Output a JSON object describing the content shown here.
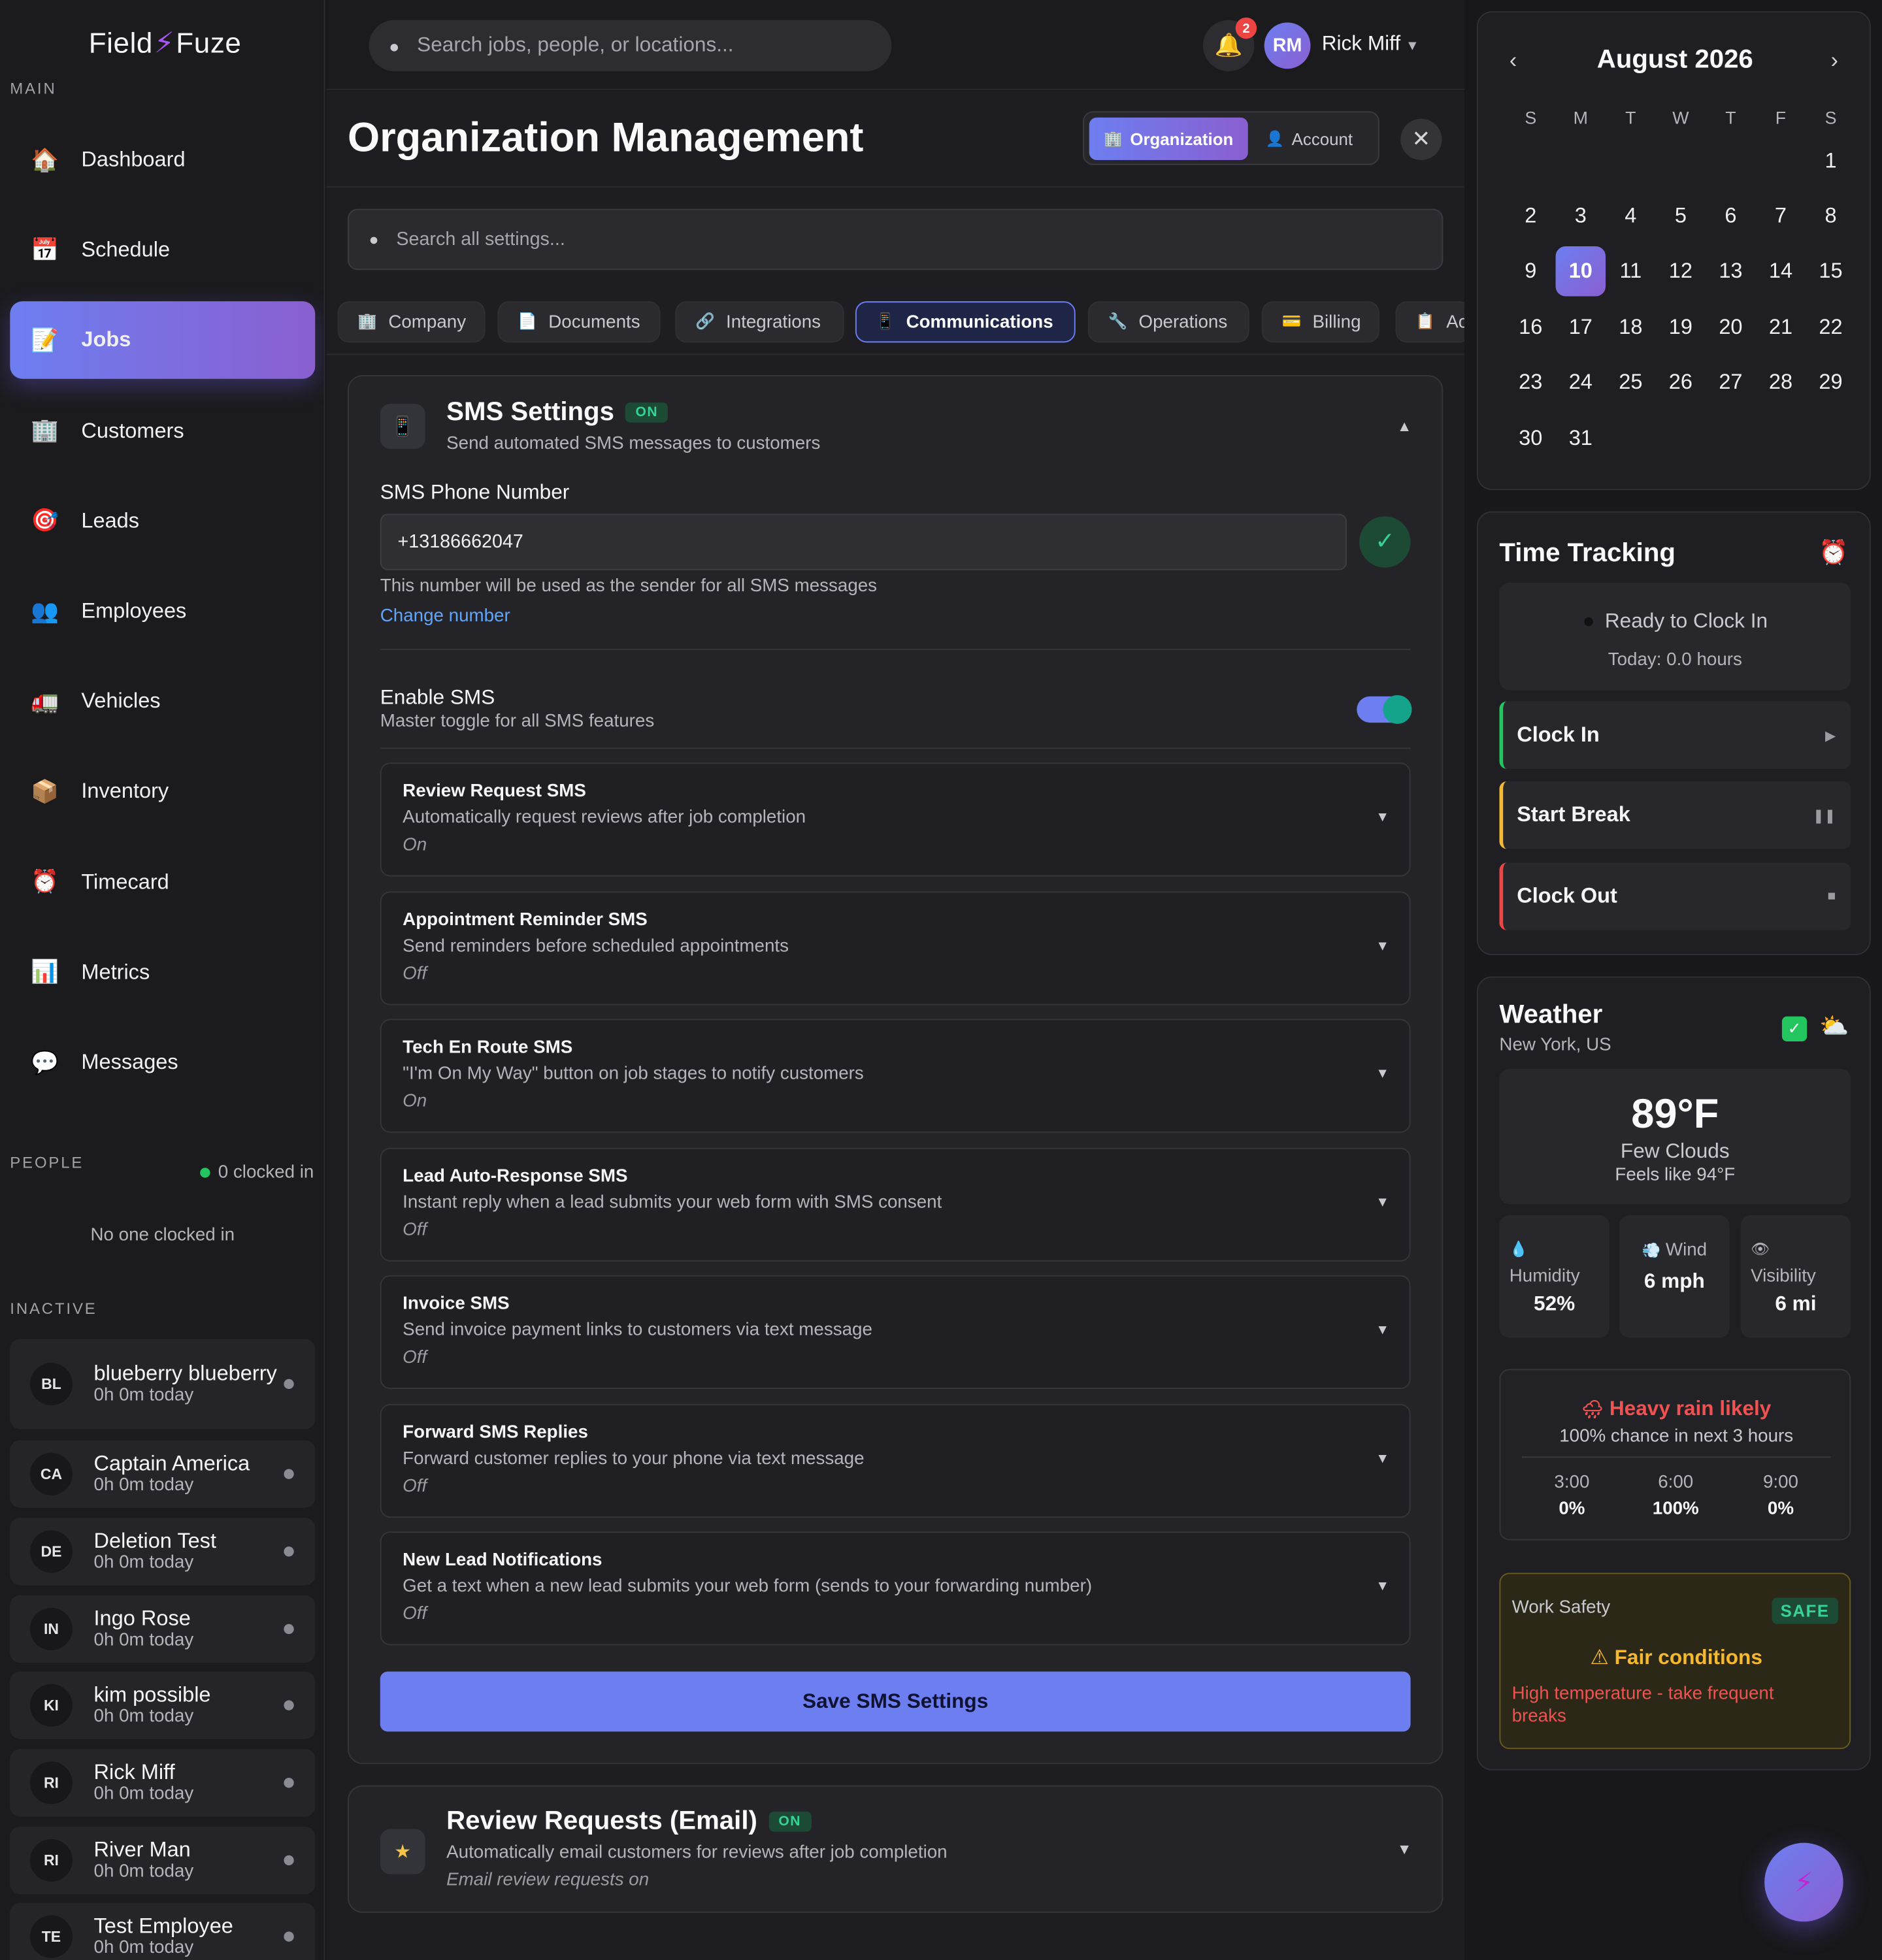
{
  "brand": {
    "name_left": "Field",
    "name_right": "Fuze",
    "logo_icon": "lightning-bolt-icon"
  },
  "sidebar": {
    "main_label": "MAIN",
    "items": [
      {
        "label": "Dashboard",
        "icon": "house-icon",
        "glyph": "🏠",
        "active": false
      },
      {
        "label": "Schedule",
        "icon": "calendar-icon",
        "glyph": "📅",
        "active": false
      },
      {
        "label": "Jobs",
        "icon": "memo-icon",
        "glyph": "📝",
        "active": true
      },
      {
        "label": "Customers",
        "icon": "office-building-icon",
        "glyph": "🏢",
        "active": false
      },
      {
        "label": "Leads",
        "icon": "target-icon",
        "glyph": "🎯",
        "active": false
      },
      {
        "label": "Employees",
        "icon": "people-icon",
        "glyph": "👥",
        "active": false
      },
      {
        "label": "Vehicles",
        "icon": "truck-icon",
        "glyph": "🚛",
        "active": false
      },
      {
        "label": "Inventory",
        "icon": "package-icon",
        "glyph": "📦",
        "active": false
      },
      {
        "label": "Timecard",
        "icon": "alarm-clock-icon",
        "glyph": "⏰",
        "active": false
      },
      {
        "label": "Metrics",
        "icon": "bar-chart-icon",
        "glyph": "📊",
        "active": false
      },
      {
        "label": "Messages",
        "icon": "speech-bubble-icon",
        "glyph": "💬",
        "active": false
      }
    ],
    "people_label": "PEOPLE",
    "clocked_in": "0 clocked in",
    "no_one": "No one clocked in",
    "inactive_label": "INACTIVE",
    "employees": [
      {
        "initials": "BL",
        "name": "blueberry blueberry",
        "time": "0h 0m today"
      },
      {
        "initials": "CA",
        "name": "Captain America",
        "time": "0h 0m today"
      },
      {
        "initials": "DE",
        "name": "Deletion Test",
        "time": "0h 0m today"
      },
      {
        "initials": "IN",
        "name": "Ingo Rose",
        "time": "0h 0m today"
      },
      {
        "initials": "KI",
        "name": "kim possible",
        "time": "0h 0m today"
      },
      {
        "initials": "RI",
        "name": "Rick Miff",
        "time": "0h 0m today"
      },
      {
        "initials": "RI",
        "name": "River Man",
        "time": "0h 0m today"
      },
      {
        "initials": "TE",
        "name": "Test Employee",
        "time": "0h 0m today"
      }
    ]
  },
  "topbar": {
    "search_placeholder": "Search jobs, people, or locations...",
    "notifications": "2",
    "user_initials": "RM",
    "user_name": "Rick Miff"
  },
  "page": {
    "title": "Organization Management",
    "mode_org": "Organization",
    "mode_account": "Account",
    "settings_search_placeholder": "Search all settings...",
    "tabs": [
      {
        "label": "Company",
        "icon": "building-icon",
        "glyph": "🏢",
        "active": false
      },
      {
        "label": "Documents",
        "icon": "document-icon",
        "glyph": "📄",
        "active": false
      },
      {
        "label": "Integrations",
        "icon": "link-icon",
        "glyph": "🔗",
        "active": false
      },
      {
        "label": "Communications",
        "icon": "phone-icon",
        "glyph": "📱",
        "active": true
      },
      {
        "label": "Operations",
        "icon": "wrench-icon",
        "glyph": "🔧",
        "active": false
      },
      {
        "label": "Billing",
        "icon": "credit-card-icon",
        "glyph": "💳",
        "active": false
      },
      {
        "label": "Ac",
        "icon": "clipboard-icon",
        "glyph": "📋",
        "active": false
      }
    ]
  },
  "sms": {
    "title": "SMS Settings",
    "badge": "ON",
    "subtitle": "Send automated SMS messages to customers",
    "phone_label": "SMS Phone Number",
    "phone_value": "+13186662047",
    "phone_help": "This number will be used as the sender for all SMS messages",
    "change_link": "Change number",
    "enable_title": "Enable SMS",
    "enable_sub": "Master toggle for all SMS features",
    "enabled": true,
    "features": [
      {
        "title": "Review Request SMS",
        "desc": "Automatically request reviews after job completion",
        "status": "On"
      },
      {
        "title": "Appointment Reminder SMS",
        "desc": "Send reminders before scheduled appointments",
        "status": "Off"
      },
      {
        "title": "Tech En Route SMS",
        "desc": "\"I'm On My Way\" button on job stages to notify customers",
        "status": "On"
      },
      {
        "title": "Lead Auto-Response SMS",
        "desc": "Instant reply when a lead submits your web form with SMS consent",
        "status": "Off"
      },
      {
        "title": "Invoice SMS",
        "desc": "Send invoice payment links to customers via text message",
        "status": "Off"
      },
      {
        "title": "Forward SMS Replies",
        "desc": "Forward customer replies to your phone via text message",
        "status": "Off"
      },
      {
        "title": "New Lead Notifications",
        "desc": "Get a text when a new lead submits your web form (sends to your forwarding number)",
        "status": "Off"
      }
    ],
    "save_label": "Save SMS Settings"
  },
  "review_email": {
    "title": "Review Requests (Email)",
    "badge": "ON",
    "subtitle": "Automatically email customers for reviews after job completion",
    "status": "Email review requests on"
  },
  "calendar": {
    "month": "August 2026",
    "dow": [
      "S",
      "M",
      "T",
      "W",
      "T",
      "F",
      "S"
    ],
    "first_weekday": 6,
    "days_in_month": 31,
    "today": 10
  },
  "time_tracking": {
    "title": "Time Tracking",
    "status": "Ready to Clock In",
    "today": "Today: 0.0 hours",
    "clock_in": "Clock In",
    "start_break": "Start Break",
    "clock_out": "Clock Out"
  },
  "weather": {
    "title": "Weather",
    "location": "New York, US",
    "temp": "89°F",
    "condition": "Few Clouds",
    "feels": "Feels like 94°F",
    "humidity_label": "Humidity",
    "humidity": "52%",
    "wind_label": "Wind",
    "wind": "6 mph",
    "visibility_label": "Visibility",
    "visibility": "6 mi",
    "rain_title": "Heavy rain likely",
    "rain_sub": "100% chance in next 3 hours",
    "hours": [
      {
        "h": "3:00",
        "p": "0%"
      },
      {
        "h": "6:00",
        "p": "100%"
      },
      {
        "h": "9:00",
        "p": "0%"
      }
    ],
    "safety_label": "Work Safety",
    "safety_badge": "SAFE",
    "safety_condition": "Fair conditions",
    "safety_warning": "High temperature - take frequent breaks"
  },
  "colors": {
    "accent": "#6d7ef0",
    "accent2": "#8a5fd0",
    "success": "#34d399",
    "danger": "#f05252",
    "warning": "#f5b82e"
  }
}
